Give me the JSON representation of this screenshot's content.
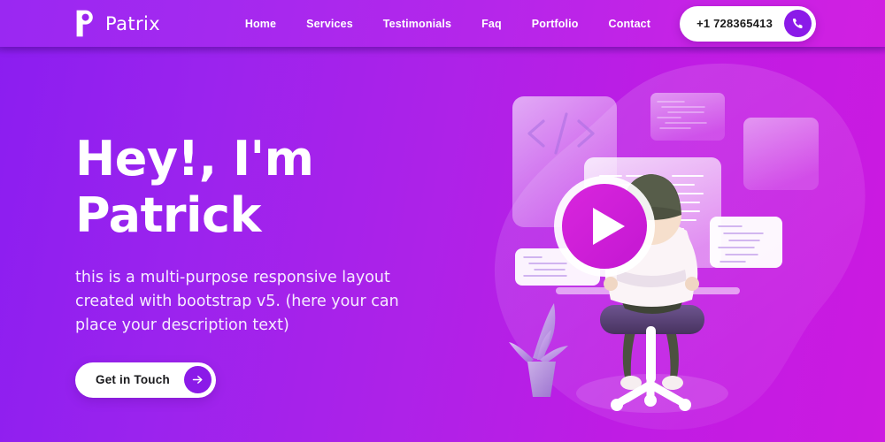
{
  "header": {
    "brand": {
      "name": "Patrix",
      "mark_icon": "patrix-p-logo-icon"
    },
    "nav": [
      {
        "label": "Home"
      },
      {
        "label": "Services"
      },
      {
        "label": "Testimonials"
      },
      {
        "label": "Faq"
      },
      {
        "label": "Portfolio"
      },
      {
        "label": "Contact"
      }
    ],
    "phone": {
      "number": "+1 728365413",
      "icon": "phone-icon"
    }
  },
  "hero": {
    "headline": "Hey!, I'm\nPatrick",
    "subtext": "this is a multi-purpose responsive layout\ncreated with bootstrap v5. (here your can\nplace your description text)",
    "cta": {
      "label": "Get in Touch",
      "icon": "arrow-right-icon"
    }
  },
  "illustration": {
    "name": "developer-at-desk-illustration",
    "code_symbol": "</>",
    "elements": [
      "code-panel-large",
      "code-snippet-panel-top",
      "code-panel-right",
      "code-window-center",
      "code-card-left",
      "code-card-right",
      "play-button",
      "person-on-office-chair",
      "potted-plant",
      "background-blob"
    ]
  },
  "colors": {
    "gradient_start": "#8b1df0",
    "gradient_end": "#cc1ae0",
    "accent_purple": "#8b1ae8",
    "play_button": "#cc1fd6",
    "text_white": "#ffffff",
    "text_dark": "#18181b"
  }
}
